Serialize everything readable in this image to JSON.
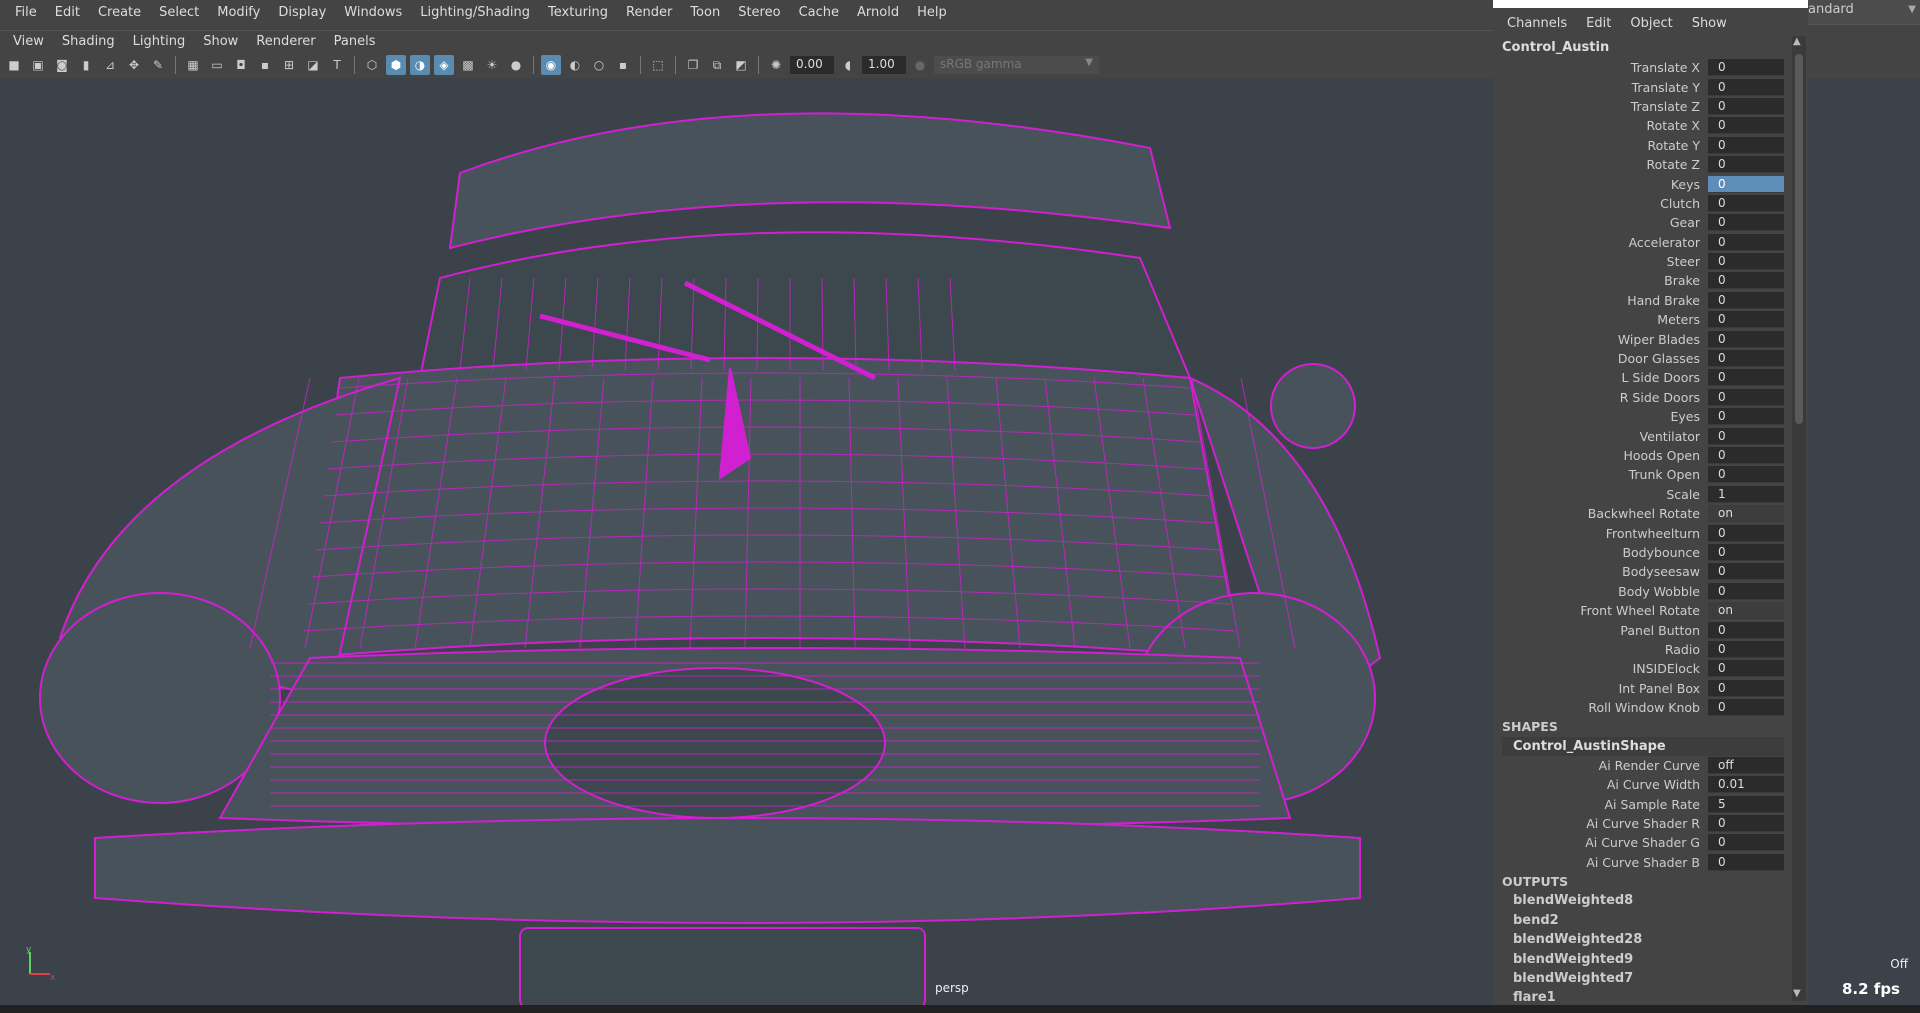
{
  "menubar": [
    "File",
    "Edit",
    "Create",
    "Select",
    "Modify",
    "Display",
    "Windows",
    "Lighting/Shading",
    "Texturing",
    "Render",
    "Toon",
    "Stereo",
    "Cache",
    "Arnold",
    "Help"
  ],
  "panel_menu": [
    "View",
    "Shading",
    "Lighting",
    "Show",
    "Renderer",
    "Panels"
  ],
  "toolbar": {
    "exposure": "0.00",
    "gamma": "1.00",
    "colorspace": "sRGB gamma"
  },
  "viewport": {
    "camera": "persp",
    "wire_color": "#d020d0",
    "bg": "#3b4249"
  },
  "channel_box": {
    "menu": [
      "Channels",
      "Edit",
      "Object",
      "Show"
    ],
    "object": "Control_Austin",
    "channels": [
      {
        "label": "Translate X",
        "value": "0"
      },
      {
        "label": "Translate Y",
        "value": "0"
      },
      {
        "label": "Translate Z",
        "value": "0"
      },
      {
        "label": "Rotate X",
        "value": "0"
      },
      {
        "label": "Rotate Y",
        "value": "0"
      },
      {
        "label": "Rotate Z",
        "value": "0"
      },
      {
        "label": "Keys",
        "value": "0",
        "selected": true
      },
      {
        "label": "Clutch",
        "value": "0"
      },
      {
        "label": "Gear",
        "value": "0"
      },
      {
        "label": "Accelerator",
        "value": "0"
      },
      {
        "label": "Steer",
        "value": "0"
      },
      {
        "label": "Brake",
        "value": "0"
      },
      {
        "label": "Hand Brake",
        "value": "0"
      },
      {
        "label": "Meters",
        "value": "0"
      },
      {
        "label": "Wiper Blades",
        "value": "0"
      },
      {
        "label": "Door Glasses",
        "value": "0"
      },
      {
        "label": "L Side Doors",
        "value": "0"
      },
      {
        "label": "R Side Doors",
        "value": "0"
      },
      {
        "label": "Eyes",
        "value": "0"
      },
      {
        "label": "Ventilator",
        "value": "0"
      },
      {
        "label": "Hoods Open",
        "value": "0"
      },
      {
        "label": "Trunk Open",
        "value": "0"
      },
      {
        "label": "Scale",
        "value": "1"
      },
      {
        "label": "Backwheel Rotate",
        "value": "on",
        "enum": true
      },
      {
        "label": "Frontwheelturn",
        "value": "0"
      },
      {
        "label": "Bodybounce",
        "value": "0"
      },
      {
        "label": "Bodyseesaw",
        "value": "0"
      },
      {
        "label": "Body Wobble",
        "value": "0"
      },
      {
        "label": "Front Wheel Rotate",
        "value": "on",
        "enum": true
      },
      {
        "label": "Panel Button",
        "value": "0"
      },
      {
        "label": "Radio",
        "value": "0"
      },
      {
        "label": "INSIDElock",
        "value": "0"
      },
      {
        "label": "Int Panel Box",
        "value": "0"
      },
      {
        "label": "Roll Window Knob",
        "value": "0"
      }
    ],
    "shapes_label": "SHAPES",
    "shape_name": "Control_AustinShape",
    "shape_channels": [
      {
        "label": "Ai Render Curve",
        "value": "off"
      },
      {
        "label": "Ai Curve Width",
        "value": "0.01"
      },
      {
        "label": "Ai Sample Rate",
        "value": "5"
      },
      {
        "label": "Ai Curve Shader R",
        "value": "0"
      },
      {
        "label": "Ai Curve Shader G",
        "value": "0"
      },
      {
        "label": "Ai Curve Shader B",
        "value": "0"
      }
    ],
    "outputs_label": "OUTPUTS",
    "outputs": [
      "blendWeighted8",
      "bend2",
      "blendWeighted28",
      "blendWeighted9",
      "blendWeighted7",
      "flare1"
    ]
  },
  "right_panel": {
    "dropdown": "andard",
    "hud_off": "Off",
    "fps": "8.2 fps"
  }
}
